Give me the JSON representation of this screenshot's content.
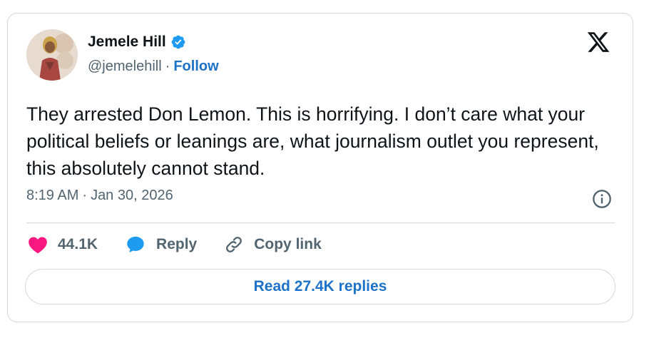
{
  "author": {
    "name": "Jemele Hill",
    "handle": "@jemelehill",
    "separator": "·",
    "follow_label": "Follow"
  },
  "tweet": {
    "text": "They arrested Don Lemon. This is horrifying. I don’t care what your political beliefs or leanings are, what journalism outlet you represent, this absolutely cannot stand.",
    "time": "8:19 AM",
    "separator": "·",
    "date": "Jan 30, 2026"
  },
  "actions": {
    "likes": "44.1K",
    "reply_label": "Reply",
    "copy_label": "Copy link"
  },
  "read_replies_label": "Read 27.4K replies",
  "colors": {
    "accent": "#1d72c7",
    "verified": "#1d9bf0",
    "like": "#f91880",
    "muted": "#536471",
    "text": "#0f1419",
    "border": "#cfd9de"
  },
  "icons": [
    "verified-badge-icon",
    "x-logo-icon",
    "info-icon",
    "heart-icon",
    "reply-bubble-icon",
    "link-icon"
  ]
}
